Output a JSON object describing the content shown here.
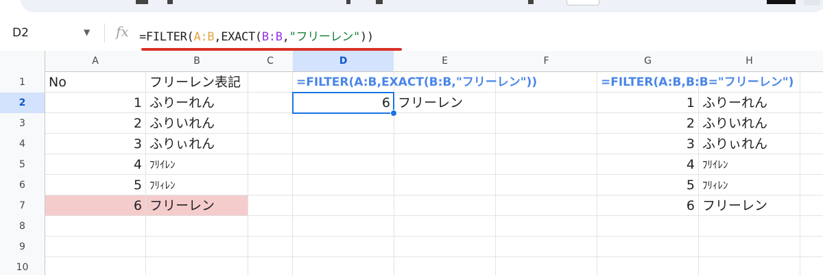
{
  "name_box": {
    "value": "D2",
    "dropdown_icon": "triangle-down-icon"
  },
  "formula_bar": {
    "fx_label": "fx",
    "formula_parts": [
      "=FILTER(",
      "A:B",
      ",EXACT(",
      "B:B",
      ",",
      "\"フリーレン\"",
      "))"
    ]
  },
  "columns": [
    "A",
    "B",
    "C",
    "D",
    "E",
    "F",
    "G",
    "H"
  ],
  "rows": [
    "1",
    "2",
    "3",
    "4",
    "5",
    "6",
    "7",
    "8",
    "9",
    "10"
  ],
  "selected_cell": {
    "column": "D",
    "row": "2"
  },
  "cells": {
    "A1": "No",
    "B1": "フリーレン表記",
    "A2": "1",
    "B2": "ふりーれん",
    "A3": "2",
    "B3": "ふりいれん",
    "A4": "3",
    "B4": "ふりぃれん",
    "A5": "4",
    "B5": "ﾌﾘｲﾚﾝ",
    "A6": "5",
    "B6": "ﾌﾘｨﾚﾝ",
    "A7": "6",
    "B7": "フリーレン",
    "D1": "=FILTER(A:B,EXACT(B:B,\"フリーレン\"))",
    "D2": "6",
    "E2": "フリーレン",
    "G1": "=FILTER(A:B,B:B=\"フリーレン\")",
    "G2": "1",
    "H2": "ふりーれん",
    "G3": "2",
    "H3": "ふりいれん",
    "G4": "3",
    "H4": "ふりぃれん",
    "G5": "4",
    "H5": "ﾌﾘｲﾚﾝ",
    "G6": "5",
    "H6": "ﾌﾘｨﾚﾝ",
    "G7": "6",
    "H7": "フリーレン"
  },
  "colors": {
    "highlight_row": "#f4cccc",
    "selection": "#1a73e8",
    "formula_label": "#4a86e8",
    "annotation_underline": "#d93025"
  }
}
